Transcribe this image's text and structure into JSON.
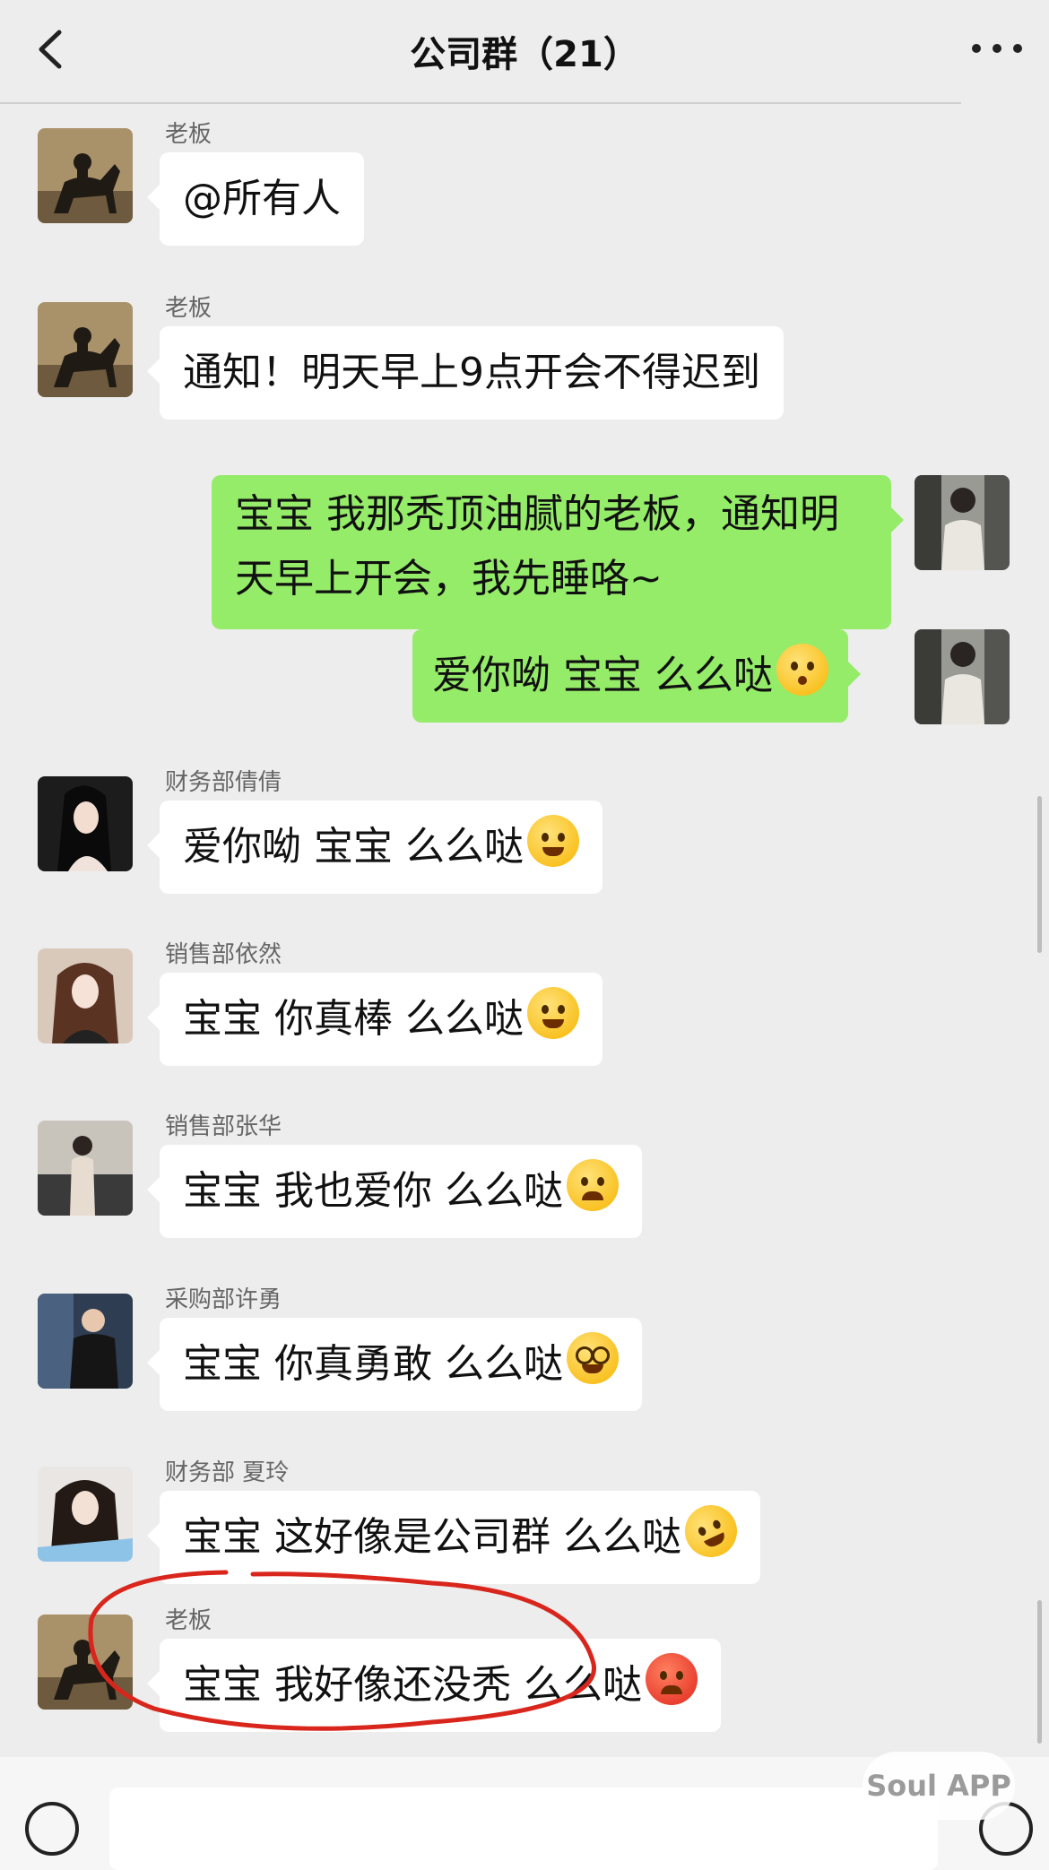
{
  "header": {
    "title": "公司群（21）"
  },
  "messages": [
    {
      "sender": "老板",
      "text": "@所有人"
    },
    {
      "sender": "老板",
      "text": "通知！明天早上9点开会不得迟到"
    },
    {
      "sender": "",
      "text": "宝宝 我那秃顶油腻的老板，通知明天早上开会，我先睡咯~"
    },
    {
      "sender": "",
      "text": "爱你呦 宝宝 么么哒"
    },
    {
      "sender": "财务部倩倩",
      "text": "爱你呦 宝宝 么么哒"
    },
    {
      "sender": "销售部依然",
      "text": "宝宝 你真棒 么么哒"
    },
    {
      "sender": "销售部张华",
      "text": "宝宝 我也爱你 么么哒"
    },
    {
      "sender": "采购部许勇",
      "text": "宝宝 你真勇敢 么么哒"
    },
    {
      "sender": "财务部 夏玲",
      "text": "宝宝 这好像是公司群 么么哒"
    },
    {
      "sender": "老板",
      "text": "宝宝 我好像还没秃 么么哒"
    }
  ],
  "watermark": "Soul APP",
  "colors": {
    "background": "#ededed",
    "self_bubble": "#95ec69",
    "other_bubble": "#ffffff",
    "annotation": "#d9261c"
  }
}
